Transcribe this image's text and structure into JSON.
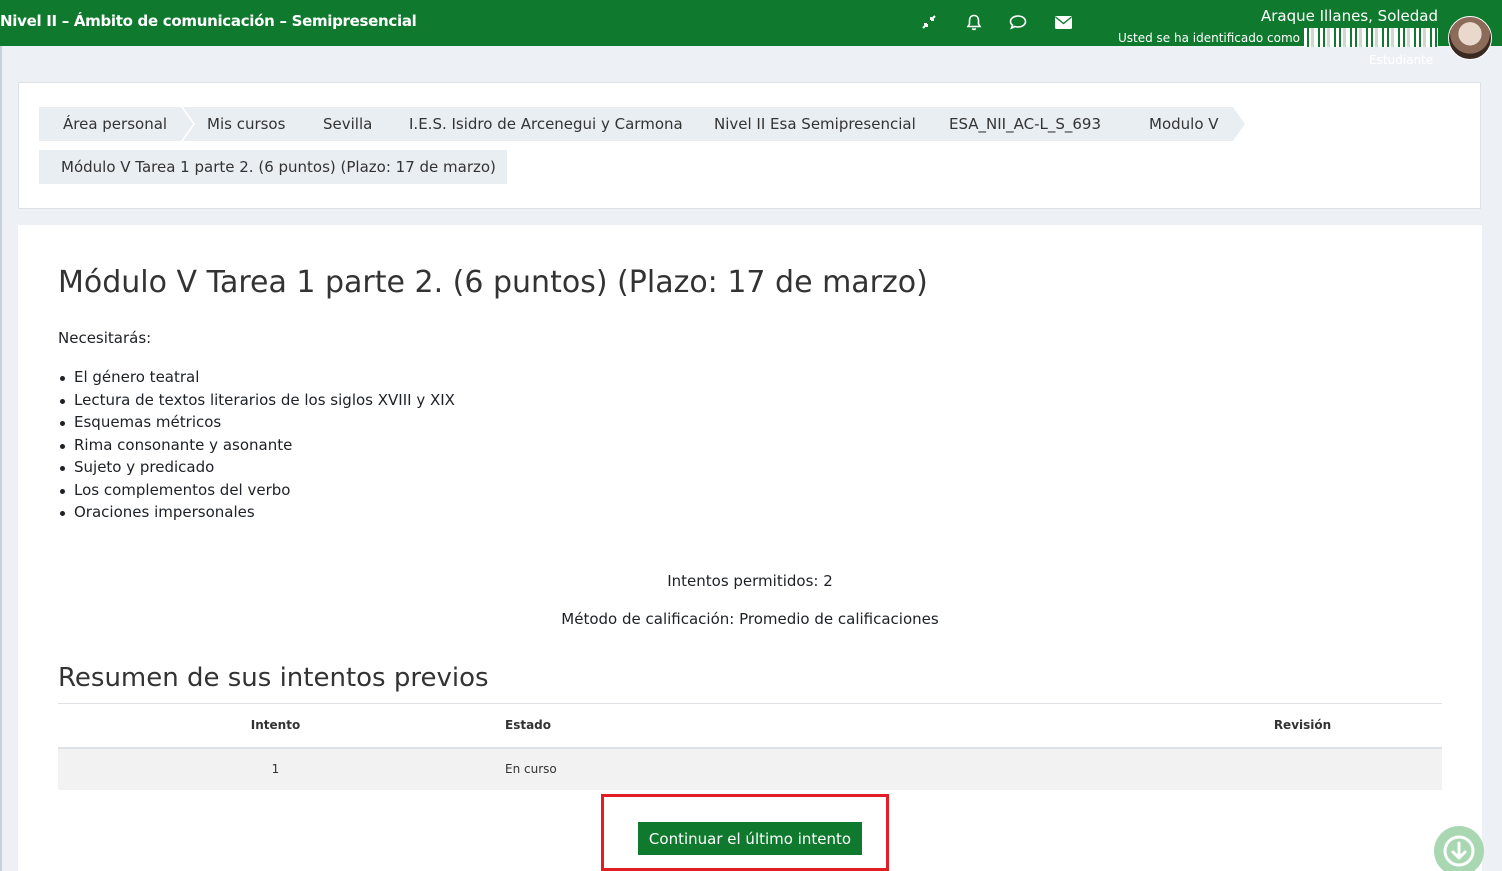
{
  "header": {
    "site_title": "Nivel II – Ámbito de comunicación – Semipresencial",
    "user_name": "Araque Illanes, Soledad",
    "logged_in_as": "Usted se ha identificado como",
    "role": "Estudiante",
    "icons": [
      "collapse-icon",
      "bell-icon",
      "chat-icon",
      "envelope-icon"
    ]
  },
  "breadcrumb": [
    "Área personal",
    "Mis cursos",
    "Sevilla",
    "I.E.S. Isidro de Arcenegui y Carmona",
    "Nivel II Esa Semipresencial",
    "ESA_NII_AC-L_S_693",
    "Modulo V",
    "Módulo V Tarea 1 parte 2. (6 puntos) (Plazo: 17 de marzo)"
  ],
  "main": {
    "title": "Módulo V Tarea 1 parte 2. (6 puntos) (Plazo: 17 de marzo)",
    "intro": "Necesitarás:",
    "topics": [
      "El género teatral",
      "Lectura de textos literarios de los siglos XVIII y XIX",
      "Esquemas métricos",
      "Rima consonante y asonante",
      "Sujeto y predicado",
      "Los complementos del verbo",
      "Oraciones impersonales"
    ],
    "attempts_allowed": "Intentos permitidos: 2",
    "grading_method": "Método de calificación: Promedio de calificaciones",
    "summary_title": "Resumen de sus intentos previos",
    "table": {
      "headers": [
        "Intento",
        "Estado",
        "Revisión"
      ],
      "rows": [
        [
          "1",
          "En curso",
          ""
        ]
      ]
    },
    "continue_button": "Continuar el último intento"
  },
  "colors": {
    "brand": "#0f7a2e",
    "highlight": "#e21d26",
    "breadcrumb_bg": "#e9eef3"
  }
}
